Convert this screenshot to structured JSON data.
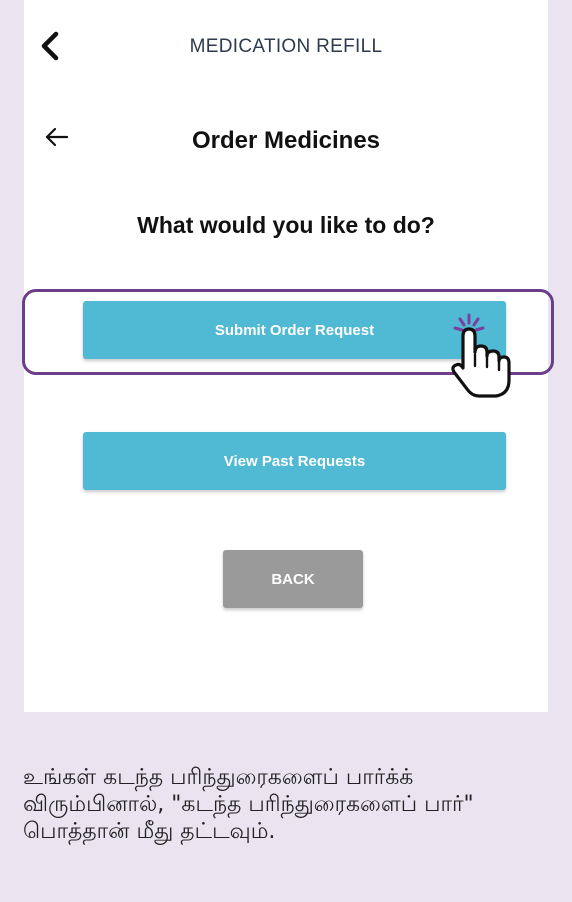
{
  "header": {
    "app_title": "MEDICATION REFILL"
  },
  "screen": {
    "title": "Order Medicines",
    "question": "What would you like to do?"
  },
  "actions": {
    "submit_label": "Submit Order Request",
    "view_label": "View Past Requests",
    "back_label": "BACK"
  },
  "instruction": {
    "text": "உங்கள் கடந்த பரிந்துரைகளைப் பார்க்க் விரும்பினால், \"கடந்த பரிந்துரைகளைப் பார்\" பொத்தான் மீது தட்டவும்."
  },
  "colors": {
    "page_background": "#e9e4f0",
    "accent_button": "#50b9d3",
    "back_button": "#9a9a9a",
    "highlight_frame": "#6b3d8a",
    "tap_indicator": "#7b3fa0"
  },
  "icons": {
    "header_back": "chevron-left-icon",
    "screen_back": "arrow-left-icon",
    "tap_pointer": "hand-pointer-icon"
  }
}
